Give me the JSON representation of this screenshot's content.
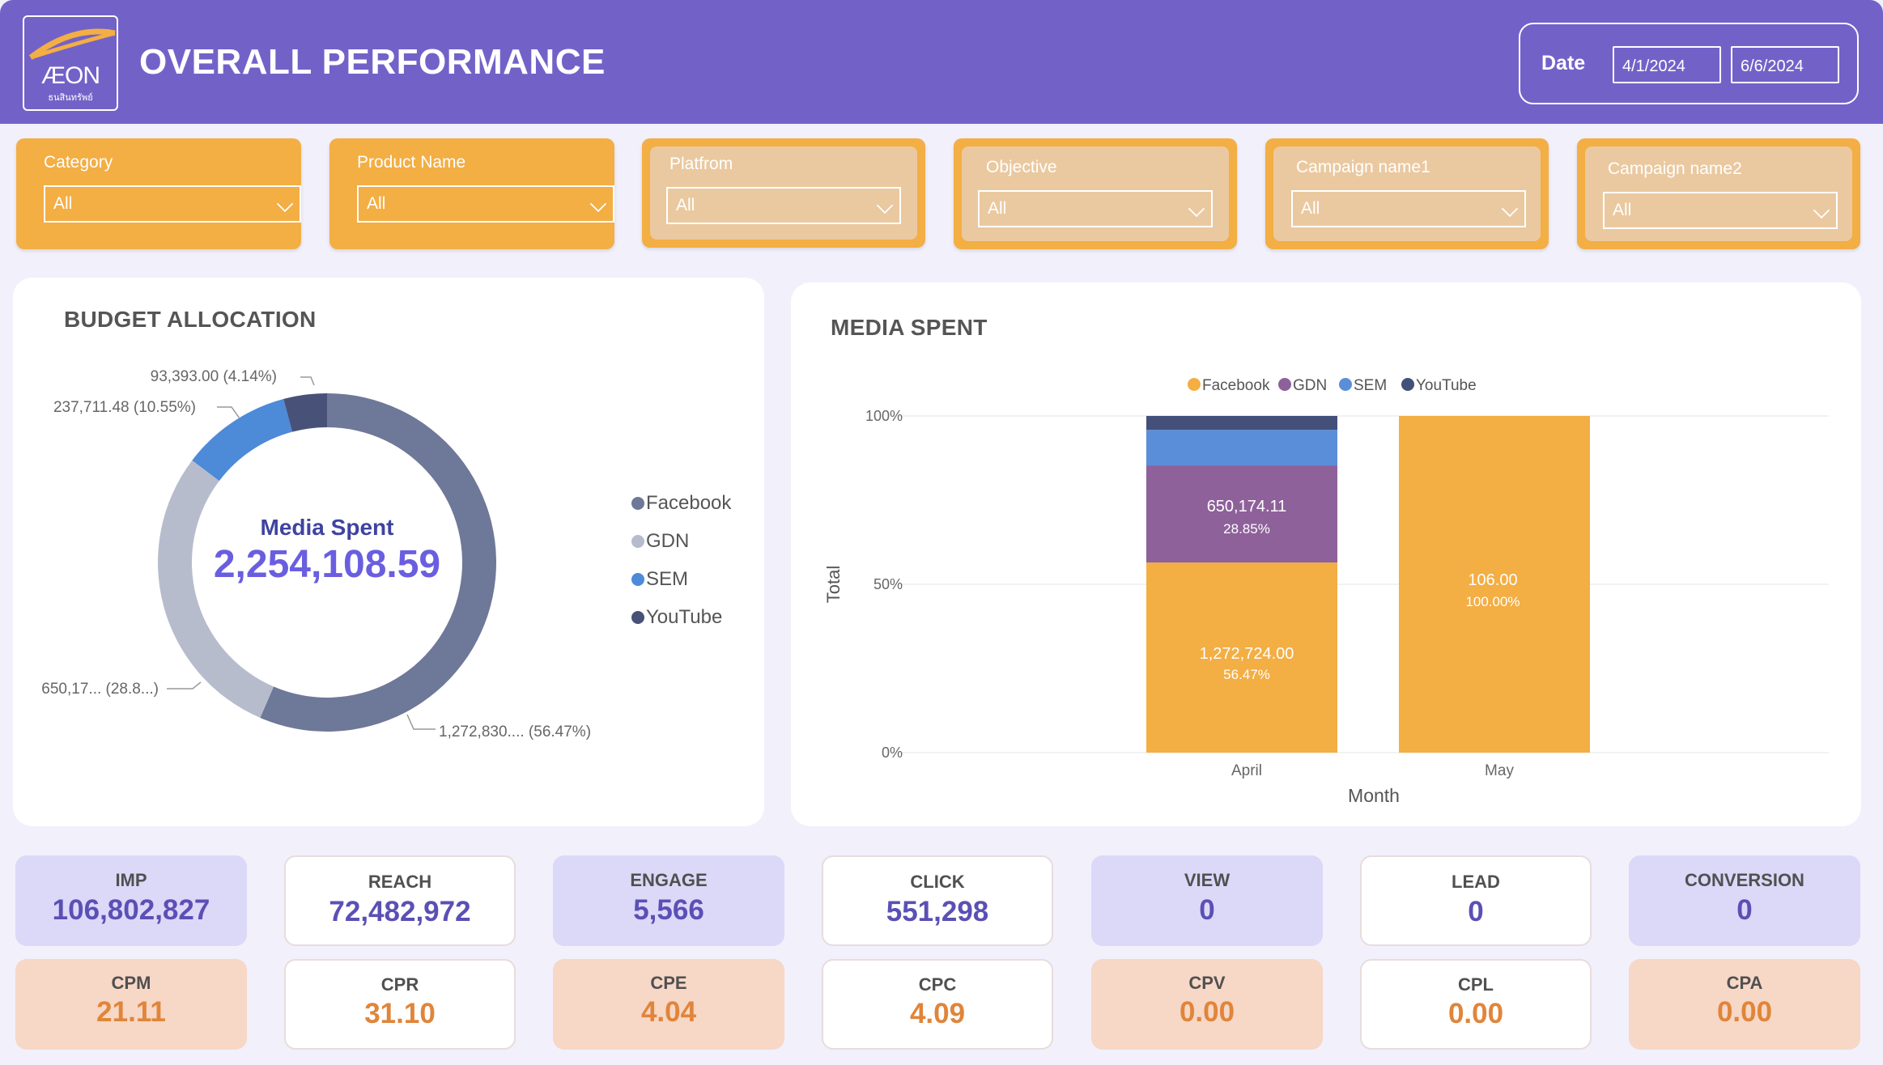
{
  "header": {
    "logo_text": "ÆON",
    "logo_sub": "ธนสินทรัพย์",
    "title": "OVERALL PERFORMANCE",
    "date_label": "Date",
    "date_start": "4/1/2024",
    "date_end": "6/6/2024"
  },
  "filters": [
    {
      "label": "Category",
      "value": "All"
    },
    {
      "label": "Product Name",
      "value": "All"
    },
    {
      "label": "Platfrom",
      "value": "All"
    },
    {
      "label": "Objective",
      "value": "All"
    },
    {
      "label": "Campaign name1",
      "value": "All"
    },
    {
      "label": "Campaign name2",
      "value": "All"
    }
  ],
  "budget": {
    "title": "BUDGET ALLOCATION",
    "center_label": "Media Spent",
    "center_value": "2,254,108.59",
    "labels": {
      "youtube": "93,393.00 (4.14%)",
      "sem": "237,711.48 (10.55%)",
      "gdn": "650,17... (28.8...)",
      "facebook": "1,272,830.... (56.47%)"
    },
    "legend": [
      "Facebook",
      "GDN",
      "SEM",
      "YouTube"
    ]
  },
  "media": {
    "title": "MEDIA SPENT",
    "legend": [
      "Facebook",
      "GDN",
      "SEM",
      "YouTube"
    ],
    "y_ticks": [
      "100%",
      "50%",
      "0%"
    ],
    "y_title": "Total",
    "x_title": "Month",
    "x_ticks": [
      "April",
      "May"
    ],
    "labels": {
      "apr_gdn_value": "650,174.11",
      "apr_gdn_pct": "28.85%",
      "apr_fb_value": "1,272,724.00",
      "apr_fb_pct": "56.47%",
      "may_fb_value": "106.00",
      "may_fb_pct": "100.00%"
    }
  },
  "chart_data": [
    {
      "type": "pie",
      "title": "BUDGET ALLOCATION",
      "categories": [
        "Facebook",
        "GDN",
        "SEM",
        "YouTube"
      ],
      "values": [
        1272830,
        650174,
        237711.48,
        93393.0
      ],
      "percent": [
        56.47,
        28.85,
        10.55,
        4.14
      ],
      "colors": [
        "#6e7898",
        "#b7bccd",
        "#4d8ad8",
        "#485278"
      ],
      "legend": "right"
    },
    {
      "type": "bar",
      "title": "MEDIA SPENT",
      "categories": [
        "April",
        "May"
      ],
      "xlabel": "Month",
      "ylabel": "Total",
      "ylim": [
        0,
        100
      ],
      "stacked": "percent",
      "series": [
        {
          "name": "Facebook",
          "values": [
            56.47,
            100.0
          ],
          "color": "#f3ae44"
        },
        {
          "name": "GDN",
          "values": [
            28.85,
            0
          ],
          "color": "#8e619a"
        },
        {
          "name": "SEM",
          "values": [
            10.55,
            0
          ],
          "color": "#5b8ed8"
        },
        {
          "name": "YouTube",
          "values": [
            4.14,
            0
          ],
          "color": "#435079"
        }
      ],
      "legend": "top"
    }
  ],
  "kpis": [
    {
      "label": "IMP",
      "value": "106,802,827"
    },
    {
      "label": "REACH",
      "value": "72,482,972"
    },
    {
      "label": "ENGAGE",
      "value": "5,566"
    },
    {
      "label": "CLICK",
      "value": "551,298"
    },
    {
      "label": "VIEW",
      "value": "0"
    },
    {
      "label": "LEAD",
      "value": "0"
    },
    {
      "label": "CONVERSION",
      "value": "0"
    }
  ],
  "costs": [
    {
      "label": "CPM",
      "value": "21.11"
    },
    {
      "label": "CPR",
      "value": "31.10"
    },
    {
      "label": "CPE",
      "value": "4.04"
    },
    {
      "label": "CPC",
      "value": "4.09"
    },
    {
      "label": "CPV",
      "value": "0.00"
    },
    {
      "label": "CPL",
      "value": "0.00"
    },
    {
      "label": "CPA",
      "value": "0.00"
    }
  ]
}
